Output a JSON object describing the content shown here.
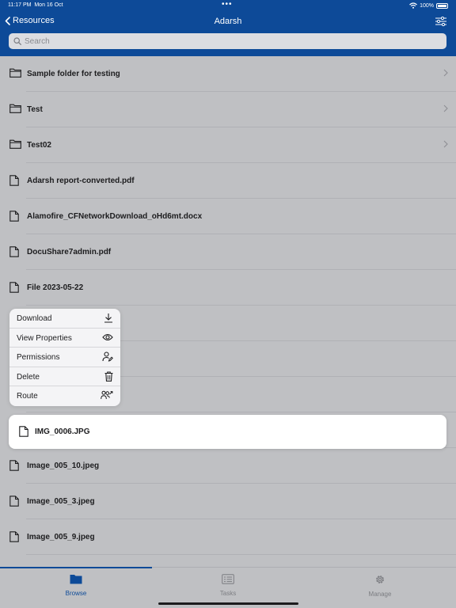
{
  "status_bar": {
    "time": "11:17 PM",
    "date": "Mon 16 Oct",
    "battery": "100%"
  },
  "navbar": {
    "back_label": "Resources",
    "title": "Adarsh"
  },
  "search": {
    "placeholder": "Search"
  },
  "items": [
    {
      "name": "Sample folder for testing",
      "type": "folder",
      "icon": "folder-icon"
    },
    {
      "name": "Test",
      "type": "folder",
      "icon": "folder-icon"
    },
    {
      "name": "Test02",
      "type": "folder",
      "icon": "folder-icon"
    },
    {
      "name": "Adarsh report-converted.pdf",
      "type": "file",
      "icon": "document-icon"
    },
    {
      "name": "Alamofire_CFNetworkDownload_oHd6mt.docx",
      "type": "file",
      "icon": "document-icon"
    },
    {
      "name": "DocuShare7admin.pdf",
      "type": "file",
      "icon": "document-icon"
    },
    {
      "name": "File 2023-05-22",
      "type": "file",
      "icon": "document-icon"
    }
  ],
  "items_after": [
    {
      "name": "Image_005_10.jpeg",
      "type": "file",
      "icon": "document-icon"
    },
    {
      "name": "Image_005_3.jpeg",
      "type": "file",
      "icon": "document-icon"
    },
    {
      "name": "Image_005_9.jpeg",
      "type": "file",
      "icon": "document-icon"
    }
  ],
  "context_menu": {
    "items": [
      {
        "label": "Download",
        "icon": "download-icon"
      },
      {
        "label": "View Properties",
        "icon": "eye-icon"
      },
      {
        "label": "Permissions",
        "icon": "user-edit-icon"
      },
      {
        "label": "Delete",
        "icon": "trash-icon"
      },
      {
        "label": "Route",
        "icon": "route-users-icon"
      }
    ]
  },
  "selected_item": {
    "name": "IMG_0006.JPG",
    "icon": "document-icon"
  },
  "tabs": [
    {
      "label": "Browse",
      "icon": "folder-icon",
      "active": true
    },
    {
      "label": "Tasks",
      "icon": "tasks-icon",
      "active": false
    },
    {
      "label": "Manage",
      "icon": "gear-icon",
      "active": false
    }
  ],
  "colors": {
    "accent": "#0d4a98",
    "background": "#bfc0c3",
    "menu": "#f4f4f6",
    "card": "#ffffff"
  }
}
